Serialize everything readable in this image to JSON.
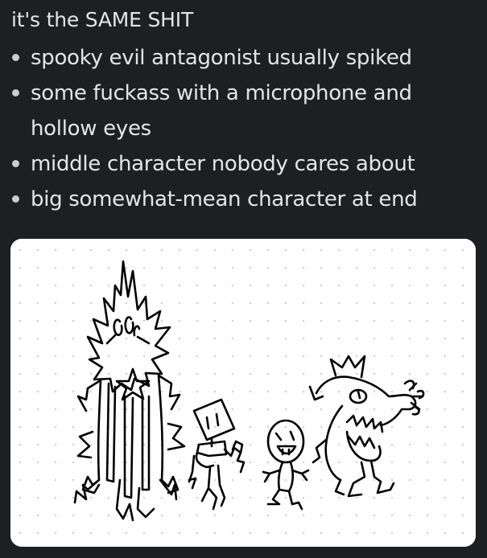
{
  "message": {
    "title": "it's the SAME SHIT",
    "bullets": [
      "spooky evil antagonist usually spiked",
      "some fuckass with a microphone and hollow eyes",
      "middle character nobody cares about",
      "big somewhat-mean character at end"
    ]
  },
  "attachment": {
    "type": "image",
    "background": "#ffffff",
    "dot_color": "#d4d4d4",
    "ink_color": "#000000"
  },
  "colors": {
    "background": "#1e1f22",
    "text": "#e3e5e8",
    "bullet": "#c9ccd1"
  }
}
